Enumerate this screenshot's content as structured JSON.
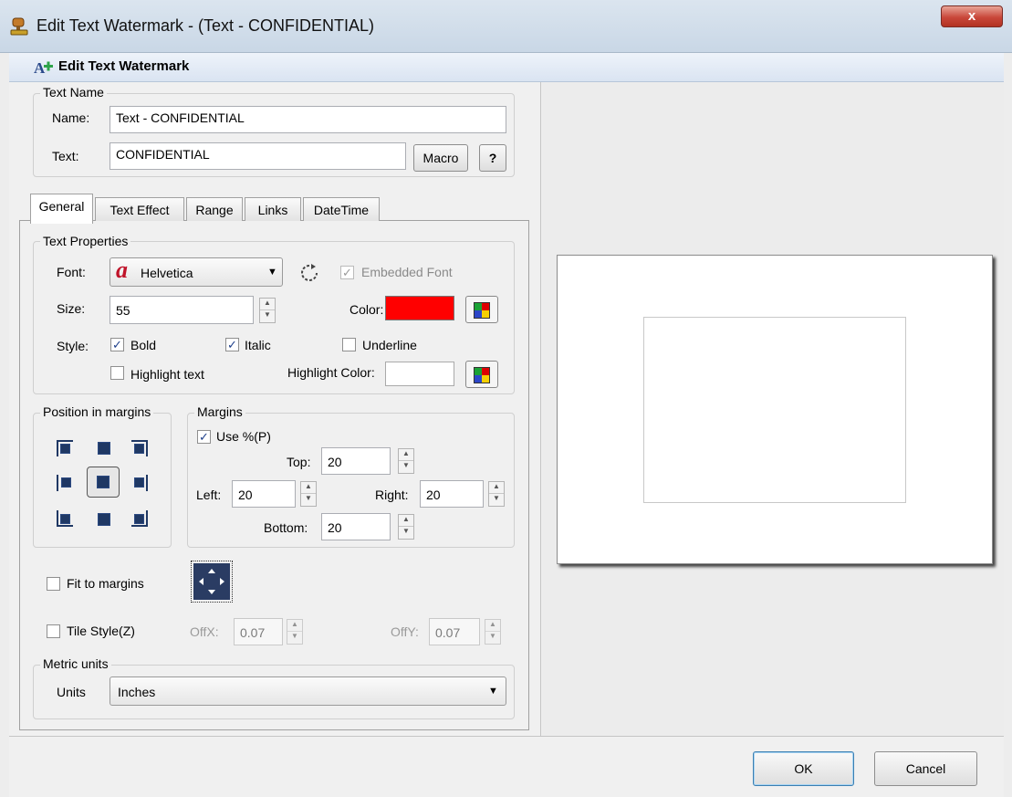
{
  "window": {
    "title": "Edit Text Watermark - (Text - CONFIDENTIAL)",
    "close_label": "x"
  },
  "header": {
    "title": "Edit Text Watermark"
  },
  "text_name": {
    "group_label": "Text Name",
    "name_label": "Name:",
    "name_value": "Text - CONFIDENTIAL",
    "text_label": "Text:",
    "text_value": "CONFIDENTIAL",
    "macro_label": "Macro",
    "help_label": "?"
  },
  "tabs": [
    {
      "label": "General"
    },
    {
      "label": "Text Effect"
    },
    {
      "label": "Range"
    },
    {
      "label": "Links"
    },
    {
      "label": "DateTime"
    }
  ],
  "text_properties": {
    "group_label": "Text Properties",
    "font_label": "Font:",
    "font_value": "Helvetica",
    "embedded_font_label": "Embedded Font",
    "size_label": "Size:",
    "size_value": "55",
    "color_label": "Color:",
    "color_value": "#ff0000",
    "style_label": "Style:",
    "bold_label": "Bold",
    "italic_label": "Italic",
    "underline_label": "Underline",
    "highlight_text_label": "Highlight text",
    "highlight_color_label": "Highlight Color:"
  },
  "position": {
    "group_label": "Position in margins"
  },
  "margins": {
    "group_label": "Margins",
    "use_percent_label": "Use %(P)",
    "top_label": "Top:",
    "top_value": "20",
    "left_label": "Left:",
    "left_value": "20",
    "right_label": "Right:",
    "right_value": "20",
    "bottom_label": "Bottom:",
    "bottom_value": "20"
  },
  "fit": {
    "label": "Fit to margins"
  },
  "tile": {
    "label": "Tile Style(Z)",
    "offx_label": "OffX:",
    "offx_value": "0.07",
    "offy_label": "OffY:",
    "offy_value": "0.07"
  },
  "metric": {
    "group_label": "Metric units",
    "units_label": "Units",
    "units_value": "Inches"
  },
  "footer": {
    "ok_label": "OK",
    "cancel_label": "Cancel"
  }
}
